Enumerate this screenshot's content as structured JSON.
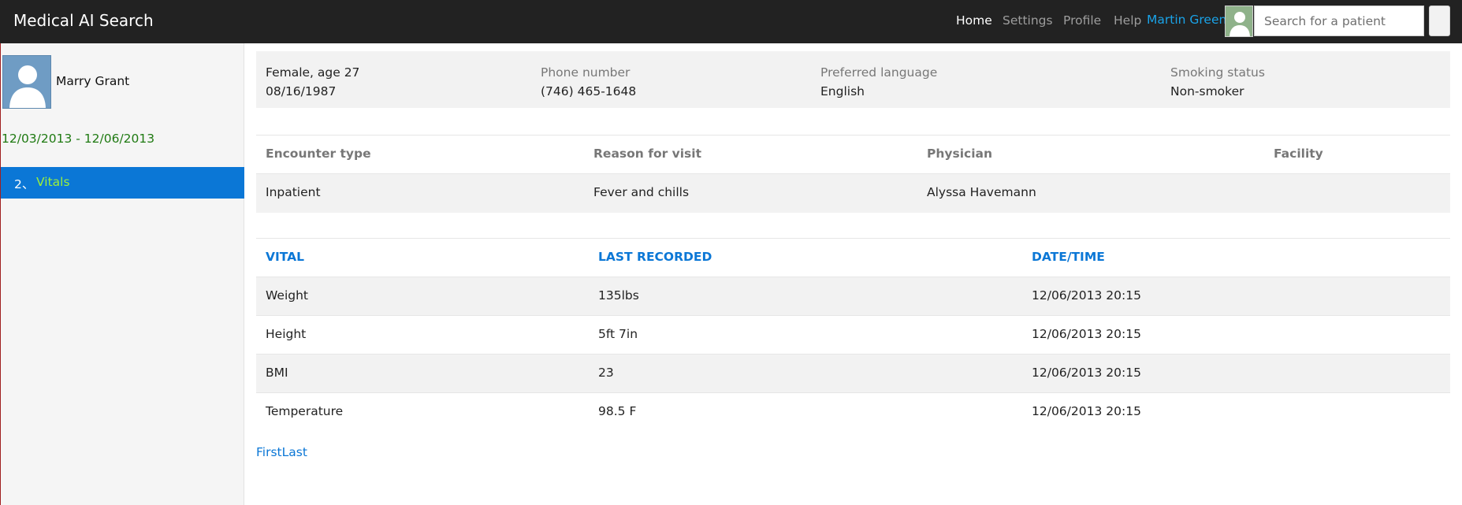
{
  "navbar": {
    "brand": "Medical AI Search",
    "links": [
      "Home",
      "Settings",
      "Profile",
      "Help"
    ],
    "user_name": "Martin Green",
    "search_placeholder": "Search for a patient"
  },
  "sidebar": {
    "patient_name": "Marry Grant",
    "date_range": "12/03/2013 - 12/06/2013",
    "nav_item": {
      "number": "2、",
      "label": "Vitals"
    }
  },
  "demographics": {
    "col1": {
      "line1": "Female, age 27",
      "line2": "08/16/1987"
    },
    "col2": {
      "label": "Phone number",
      "value": "(746) 465-1648"
    },
    "col3": {
      "label": "Preferred language",
      "value": "English"
    },
    "col4": {
      "label": "Smoking status",
      "value": "Non-smoker"
    }
  },
  "encounter": {
    "headers": [
      "Encounter type",
      "Reason for visit",
      "Physician",
      "Facility"
    ],
    "row": [
      "Inpatient",
      "Fever and chills",
      "Alyssa Havemann",
      ""
    ]
  },
  "vitals": {
    "headers": [
      "VITAL",
      "LAST RECORDED",
      "DATE/TIME"
    ],
    "rows": [
      [
        "Weight",
        "135lbs",
        "12/06/2013 20:15"
      ],
      [
        "Height",
        "5ft 7in",
        "12/06/2013 20:15"
      ],
      [
        "BMI",
        "23",
        "12/06/2013 20:15"
      ],
      [
        "Temperature",
        "98.5 F",
        "12/06/2013 20:15"
      ]
    ]
  },
  "pager": {
    "first": "First",
    "last": "Last"
  }
}
